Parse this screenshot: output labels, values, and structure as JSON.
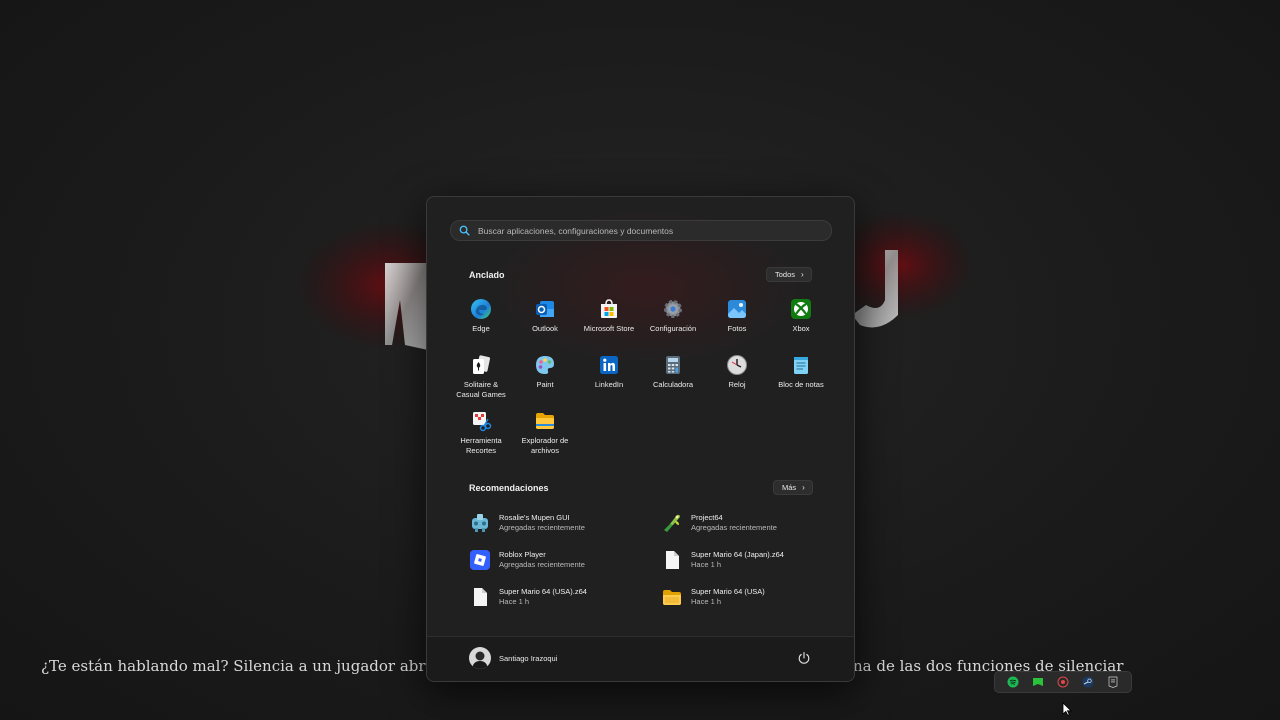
{
  "background": {
    "caption_left": "¿Te están hablando mal? Silencia a un jugador abriendo el chat",
    "caption_right": "na de las dos funciones de silenciar"
  },
  "start_menu": {
    "search": {
      "placeholder": "Buscar aplicaciones, configuraciones y documentos",
      "value": "",
      "icon": "search-icon"
    },
    "pinned": {
      "title": "Anclado",
      "all_button": "Todos",
      "apps": [
        {
          "label": "Edge",
          "icon": "edge-icon"
        },
        {
          "label": "Outlook",
          "icon": "outlook-icon"
        },
        {
          "label": "Microsoft Store",
          "icon": "store-icon"
        },
        {
          "label": "Configuración",
          "icon": "settings-gear-icon"
        },
        {
          "label": "Fotos",
          "icon": "photos-icon"
        },
        {
          "label": "Xbox",
          "icon": "xbox-icon"
        },
        {
          "label": "Solitaire &\nCasual Games",
          "label_line1": "Solitaire &",
          "label_line2": "Casual Games",
          "icon": "solitaire-icon"
        },
        {
          "label": "Paint",
          "icon": "paint-icon"
        },
        {
          "label": "LinkedIn",
          "icon": "linkedin-icon"
        },
        {
          "label": "Calculadora",
          "icon": "calculator-icon"
        },
        {
          "label": "Reloj",
          "icon": "clock-icon"
        },
        {
          "label": "Bloc de notas",
          "icon": "notepad-icon"
        },
        {
          "label_line1": "Herramienta",
          "label_line2": "Recortes",
          "icon": "snipping-tool-icon"
        },
        {
          "label_line1": "Explorador de",
          "label_line2": "archivos",
          "icon": "file-explorer-icon"
        }
      ]
    },
    "recommended": {
      "title": "Recomendaciones",
      "more_button": "Más",
      "items": [
        {
          "name": "Rosalie's Mupen GUI",
          "sub": "Agregadas recientemente",
          "icon": "mupen-icon"
        },
        {
          "name": "Project64",
          "sub": "Agregadas recientemente",
          "icon": "project64-icon"
        },
        {
          "name": "Roblox Player",
          "sub": "Agregadas recientemente",
          "icon": "roblox-icon"
        },
        {
          "name": "Super Mario 64 (Japan).z64",
          "sub": "Hace 1 h",
          "icon": "file-icon"
        },
        {
          "name": "Super Mario 64 (USA).z64",
          "sub": "Hace 1 h",
          "icon": "file-icon"
        },
        {
          "name": "Super Mario 64 (USA)",
          "sub": "Hace 1 h",
          "icon": "folder-icon"
        }
      ]
    },
    "footer": {
      "user_name": "Santiago Irazoqui",
      "power_icon": "power-icon"
    }
  },
  "tray": {
    "icons": [
      "spotify-icon",
      "game-icon",
      "headset-icon",
      "steam-icon",
      "epic-icon"
    ]
  },
  "colors": {
    "menu_bg": "#202020",
    "accent_blue": "#0a84d8",
    "text": "#ececec"
  }
}
